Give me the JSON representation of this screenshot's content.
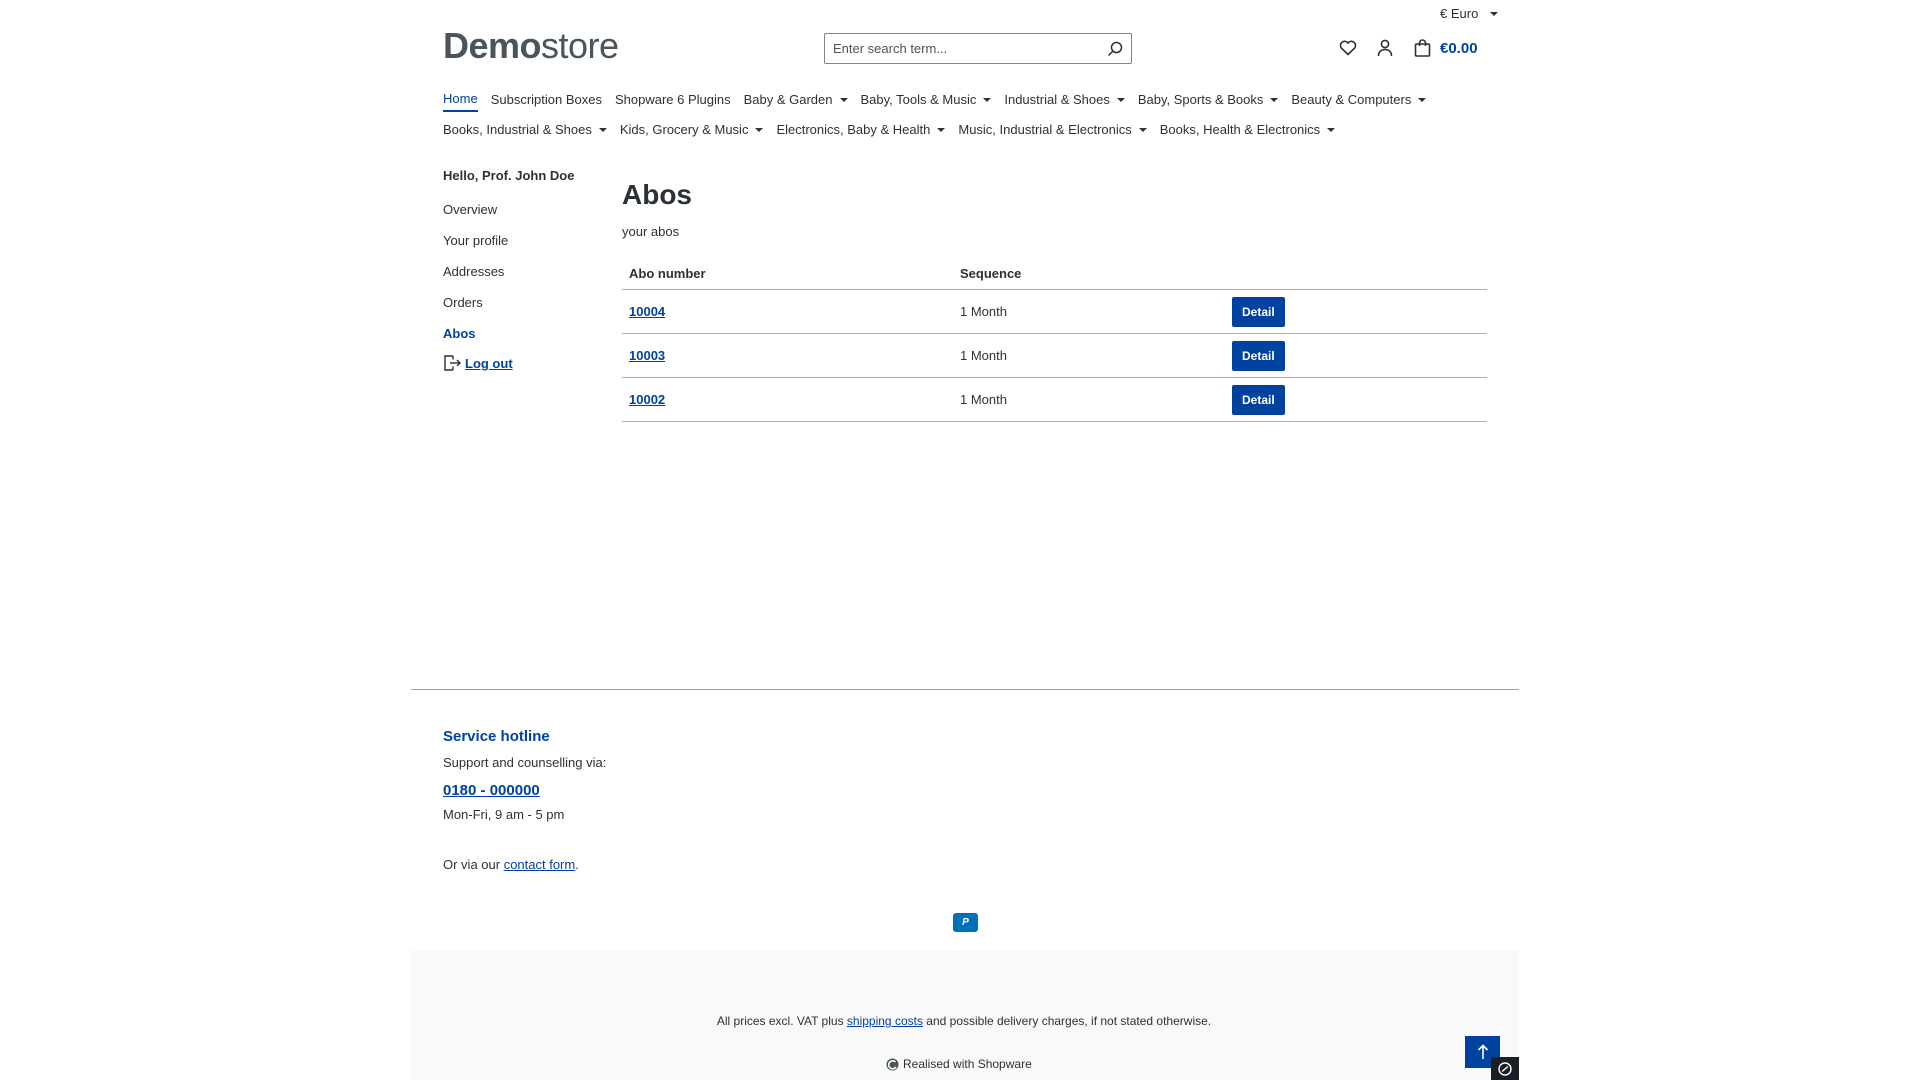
{
  "currency": {
    "label": "€ Euro"
  },
  "logo": {
    "strong": "Demo",
    "light": "store"
  },
  "search": {
    "placeholder": "Enter search term..."
  },
  "header": {
    "cart_total": "€0.00"
  },
  "nav": {
    "row1": [
      {
        "label": "Home",
        "active": true,
        "dropdown": false
      },
      {
        "label": "Subscription Boxes",
        "dropdown": false
      },
      {
        "label": "Shopware 6 Plugins",
        "dropdown": false
      },
      {
        "label": "Baby & Garden",
        "dropdown": true
      },
      {
        "label": "Baby, Tools & Music",
        "dropdown": true
      },
      {
        "label": "Industrial & Shoes",
        "dropdown": true
      },
      {
        "label": "Baby, Sports & Books",
        "dropdown": true
      },
      {
        "label": "Beauty & Computers",
        "dropdown": true
      }
    ],
    "row2": [
      {
        "label": "Books, Industrial & Shoes",
        "dropdown": true
      },
      {
        "label": "Kids, Grocery & Music",
        "dropdown": true
      },
      {
        "label": "Electronics, Baby & Health",
        "dropdown": true
      },
      {
        "label": "Music, Industrial & Electronics",
        "dropdown": true
      },
      {
        "label": "Books, Health & Electronics",
        "dropdown": true
      }
    ]
  },
  "sidebar": {
    "greeting": "Hello, Prof. John Doe",
    "links": [
      {
        "label": "Overview"
      },
      {
        "label": "Your profile"
      },
      {
        "label": "Addresses"
      },
      {
        "label": "Orders"
      },
      {
        "label": "Abos",
        "active": true
      }
    ],
    "logout": "Log out"
  },
  "main": {
    "title": "Abos",
    "subtitle": "your abos",
    "columns": [
      "Abo number",
      "Sequence"
    ],
    "rows": [
      {
        "number": "10004",
        "sequence": "1 Month",
        "action": "Detail"
      },
      {
        "number": "10003",
        "sequence": "1 Month",
        "action": "Detail"
      },
      {
        "number": "10002",
        "sequence": "1 Month",
        "action": "Detail"
      }
    ]
  },
  "footer": {
    "hotline_title": "Service hotline",
    "support_text": "Support and counselling via:",
    "phone": "0180 - 000000",
    "hours": "Mon-Fri, 9 am - 5 pm",
    "contact_prefix": "Or via our ",
    "contact_link": "contact form",
    "contact_suffix": ".",
    "payment_badge": "P",
    "vat_prefix": "All prices excl. VAT plus ",
    "vat_link": "shipping costs",
    "vat_suffix": " and possible delivery charges, if not stated otherwise.",
    "realised": "Realised with Shopware"
  },
  "colors": {
    "accent": "#0042a0",
    "text": "#2b3136",
    "footer_bg": "#f9f9f9"
  }
}
